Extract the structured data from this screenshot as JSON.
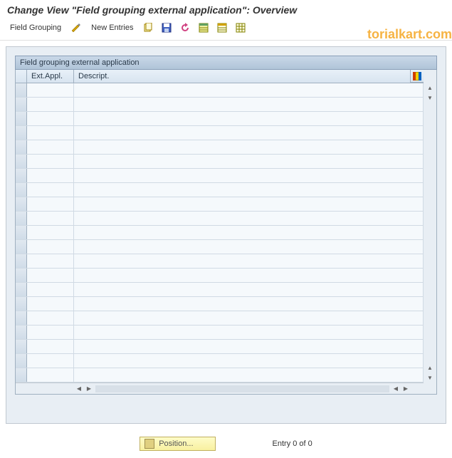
{
  "title": "Change View \"Field grouping external application\": Overview",
  "toolbar": {
    "field_grouping_label": "Field Grouping",
    "new_entries_label": "New Entries"
  },
  "watermark": "torialkart.com",
  "table": {
    "title": "Field grouping external application",
    "columns": {
      "ext_appl": "Ext.Appl.",
      "descript": "Descript."
    },
    "row_count": 21
  },
  "footer": {
    "position_label": "Position...",
    "entry_status": "Entry 0 of 0"
  }
}
